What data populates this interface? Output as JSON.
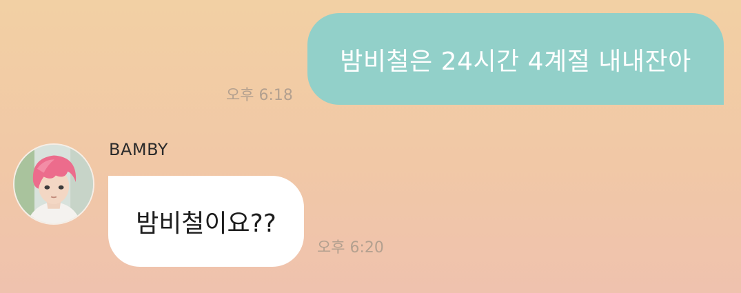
{
  "messages": {
    "outgoing": {
      "text": "밤비철은 24시간 4계절 내내잔아",
      "time": "오후 6:18"
    },
    "incoming": {
      "sender": "BAMBY",
      "text": "밤비철이요??",
      "time": "오후 6:20",
      "avatar_icon": "profile-avatar-pink-hair"
    }
  },
  "colors": {
    "background_top": "#f2d0a4",
    "background_bottom": "#efc2ae",
    "outgoing_bubble": "#92d0c9",
    "incoming_bubble": "#ffffff",
    "timestamp": "#b3a08f"
  }
}
